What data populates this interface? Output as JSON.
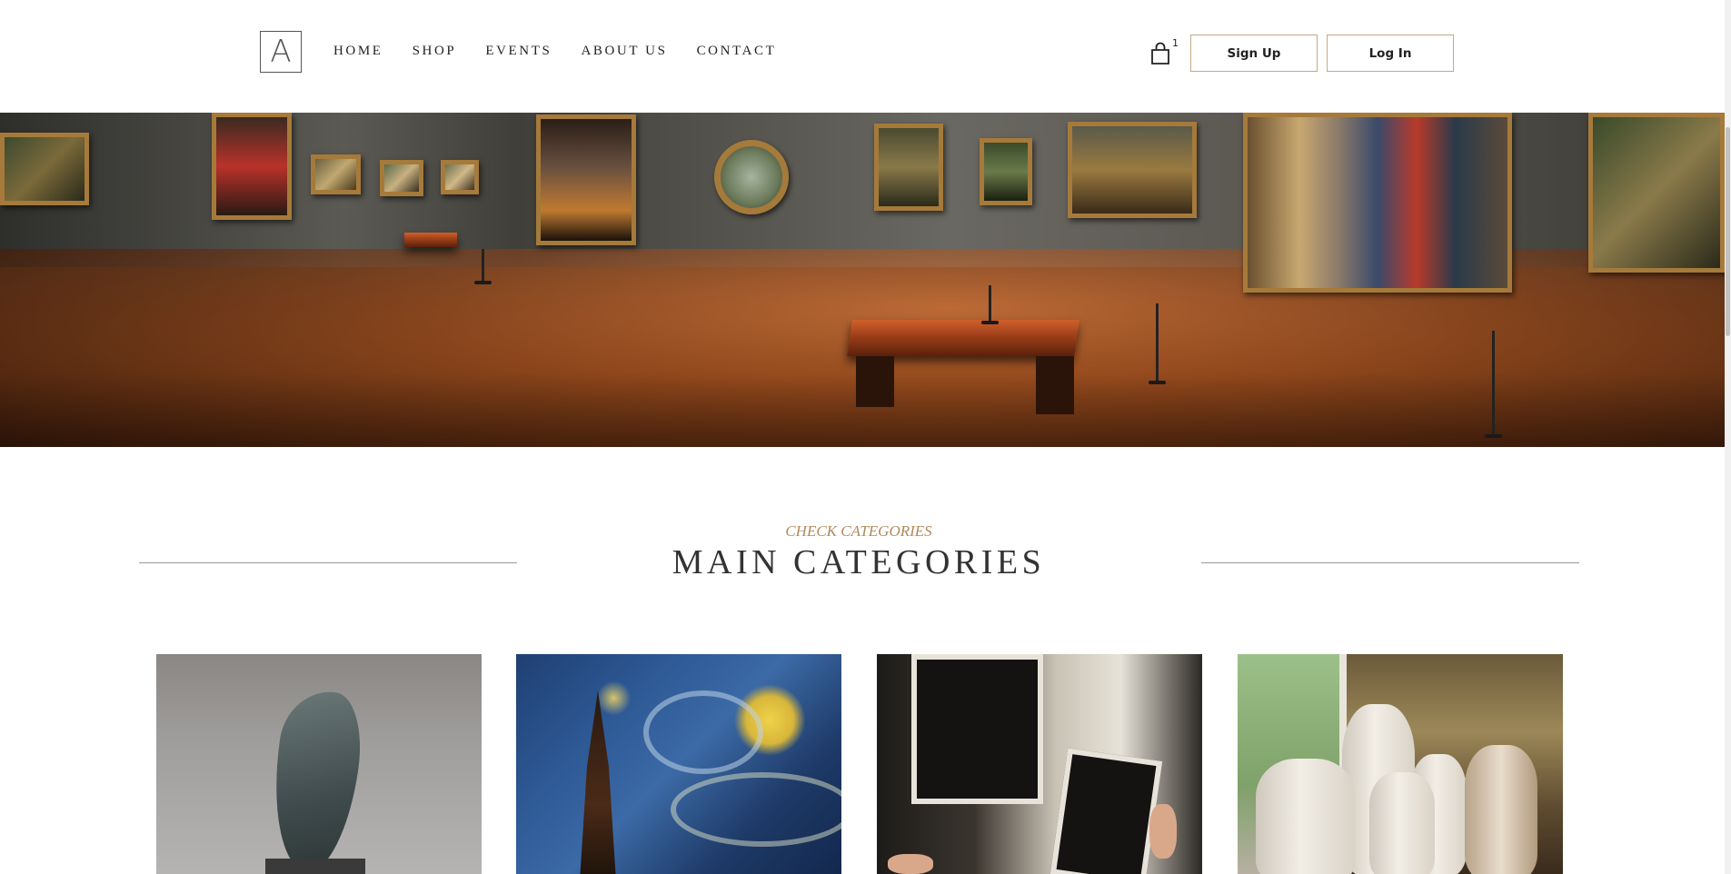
{
  "header": {
    "logo_letter": "A",
    "nav": [
      "HOME",
      "SHOP",
      "EVENTS",
      "ABOUT US",
      "CONTACT"
    ],
    "cart_icon": "shopping-bag-icon",
    "cart_count": "1",
    "signup_label": "Sign Up",
    "login_label": "Log In"
  },
  "section": {
    "subtitle": "CHECK CATEGORIES",
    "title": "MAIN CATEGORIES"
  },
  "colors": {
    "accent": "#b08a5c",
    "button_border": "#c8a881",
    "text": "#333333"
  }
}
